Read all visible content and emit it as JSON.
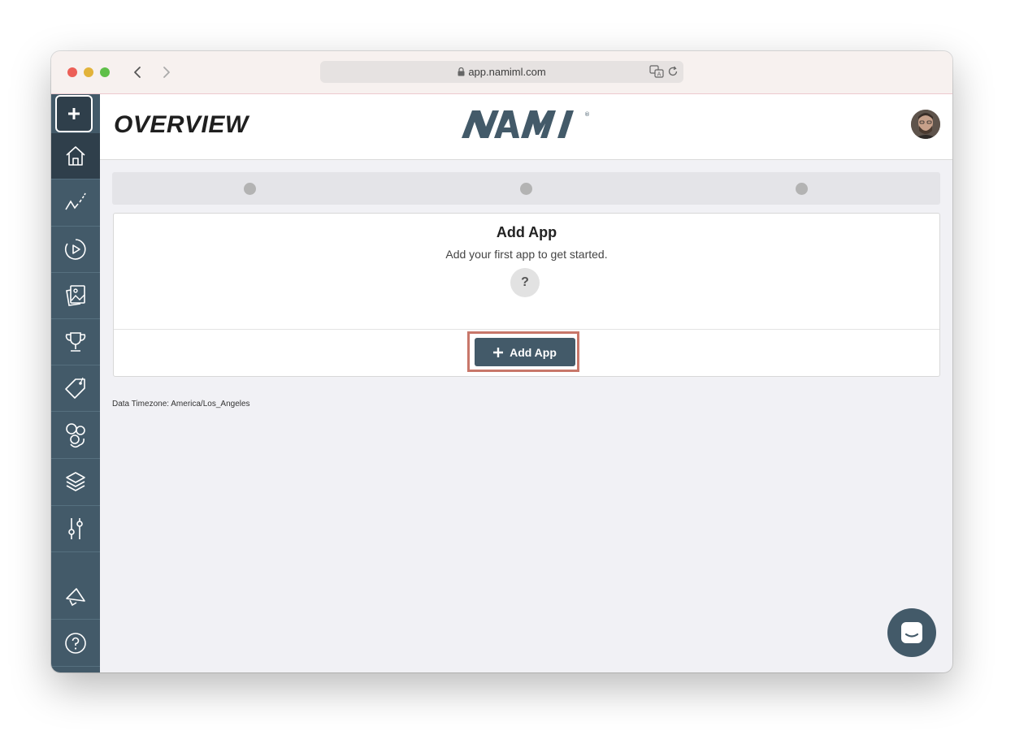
{
  "browser": {
    "url": "app.namiml.com"
  },
  "header": {
    "page_title": "OVERVIEW",
    "logo_text": "NAMI"
  },
  "sidebar": {
    "items": [
      {
        "icon": "plus-icon"
      },
      {
        "icon": "home-icon"
      },
      {
        "icon": "analytics-icon"
      },
      {
        "icon": "campaign-play-icon"
      },
      {
        "icon": "paywalls-icon"
      },
      {
        "icon": "trophy-icon"
      },
      {
        "icon": "tag-icon"
      },
      {
        "icon": "users-icon"
      },
      {
        "icon": "layers-icon"
      },
      {
        "icon": "sliders-icon"
      },
      {
        "icon": "announcement-icon"
      },
      {
        "icon": "help-icon"
      }
    ]
  },
  "card": {
    "title": "Add App",
    "subtitle": "Add your first app to get started.",
    "help_glyph": "?",
    "button_label": "Add App"
  },
  "footer": {
    "timezone": "Data Timezone: America/Los_Angeles"
  },
  "colors": {
    "sidebar": "#435a69",
    "sidebar_active": "#2f3f4b",
    "accent": "#435a69",
    "highlight": "#c8776a"
  }
}
